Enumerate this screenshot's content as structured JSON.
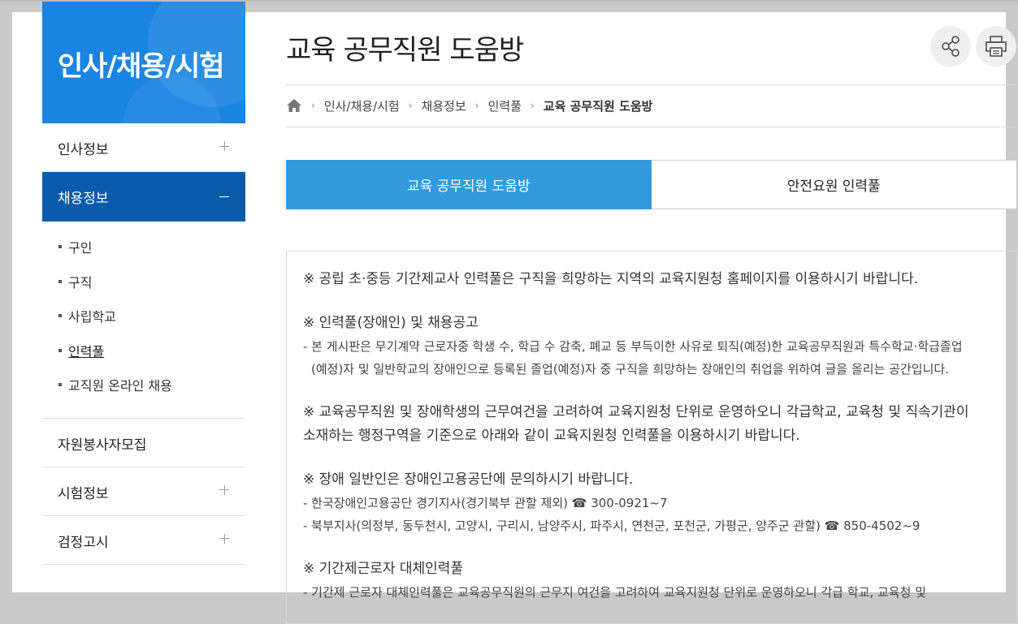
{
  "sidebar": {
    "title": "인사/채용/시험",
    "menu": [
      {
        "label": "인사정보"
      },
      {
        "label": "채용정보"
      },
      {
        "label": "자원봉사자모집"
      },
      {
        "label": "시험정보"
      },
      {
        "label": "검정고시"
      }
    ],
    "submenu": [
      {
        "label": "구인"
      },
      {
        "label": "구직"
      },
      {
        "label": "사립학교"
      },
      {
        "label": "인력풀"
      },
      {
        "label": "교직원 온라인 채용"
      }
    ]
  },
  "page": {
    "title": "교육 공무직원 도움방"
  },
  "breadcrumb": {
    "items": [
      "인사/채용/시험",
      "채용정보",
      "인력풀",
      "교육 공무직원 도움방"
    ]
  },
  "tabs": [
    {
      "label": "교육 공무직원 도움방"
    },
    {
      "label": "안전요원 인력풀"
    }
  ],
  "content": {
    "p1": "※ 공립 초·중등 기간제교사 인력풀은 구직을 희망하는 지역의 교육지원청 홈페이지를 이용하시기 바랍니다.",
    "p2_head": "※ 인력풀(장애인) 및 채용공고",
    "p2_line1": "- 본 게시판은 무기계약 근로자중 학생 수, 학급 수 감축, 폐교 등 부득이한 사유로 퇴직(예정)한 교육공무직원과 특수학교·학급졸업",
    "p2_line2": "(예정)자 및 일반학교의 장애인으로 등록된 졸업(예정)자 중 구직을 희망하는 장애인의 취업을 위하여 글을 올리는 공간입니다.",
    "p3_line1": "※ 교육공무직원 및 장애학생의 근무여건을 고려하여 교육지원청 단위로 운영하오니 각급학교, 교육청 및 직속기관이",
    "p3_line2": "소재하는 행정구역을 기준으로 아래와 같이 교육지원청 인력풀을 이용하시기 바랍니다.",
    "p4_head": "※ 장애 일반인은 장애인고용공단에 문의하시기 바랍니다.",
    "p4_line1": "- 한국장애인고용공단 경기지사(경기북부 관할 제외) ☎ 300-0921~7",
    "p4_line2": "- 북부지사(의정부, 동두천시, 고양시, 구리시, 남양주시, 파주시, 연천군, 포천군, 가평군, 양주군 관할) ☎ 850-4502~9",
    "p5_head": "※ 기간제근로자 대체인력풀",
    "p5_line1": "- 기간제 근로자 대체인력풀은 교육공무직원의 근무지 여건을 고려하여 교육지원청 단위로 운영하오니 각급 학교, 교육청 및"
  },
  "colors": {
    "banner": "#1a84e2",
    "active_menu": "#0a5bab",
    "active_tab": "#329bdd"
  },
  "icons": [
    "home-icon",
    "share-icon",
    "print-icon"
  ]
}
